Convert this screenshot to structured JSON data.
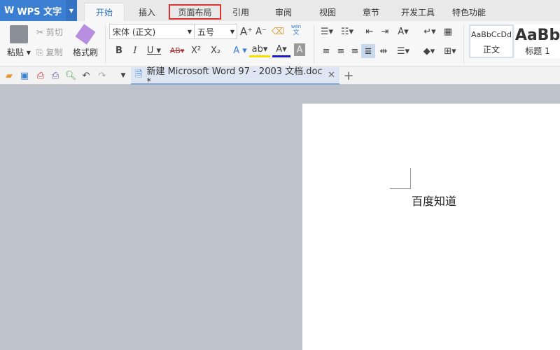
{
  "app": {
    "menu_label": "WPS 文字"
  },
  "tabs": [
    {
      "label": "开始",
      "active": true
    },
    {
      "label": "插入"
    },
    {
      "label": "页面布局",
      "highlighted": true
    },
    {
      "label": "引用"
    },
    {
      "label": "审阅"
    },
    {
      "label": "视图"
    },
    {
      "label": "章节"
    },
    {
      "label": "开发工具"
    },
    {
      "label": "特色功能"
    }
  ],
  "ribbon": {
    "paste": "粘贴",
    "cut": "剪切",
    "copy": "复制",
    "format_painter": "格式刷",
    "font_name": "宋体 (正文)",
    "font_size": "五号",
    "phonetic": "wén",
    "styles": [
      {
        "preview": "AaBbCcDd",
        "label": "正文"
      },
      {
        "preview": "AaBb",
        "label": "标题 1"
      }
    ]
  },
  "document_tab": {
    "title": "新建 Microsoft Word 97 - 2003 文档.doc *"
  },
  "document": {
    "text": "百度知道"
  },
  "colors": {
    "accent": "#3b7fd2",
    "highlight_box": "#e03030",
    "font_color": "#1a1acc",
    "highlight_color": "#f5e000"
  }
}
